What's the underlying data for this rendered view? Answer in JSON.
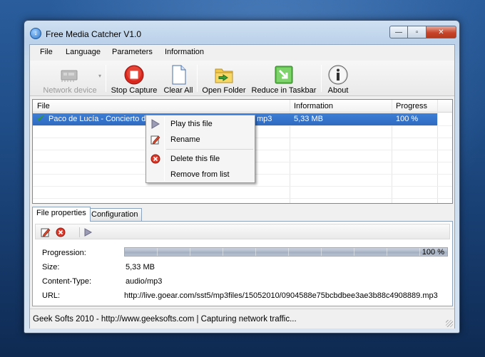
{
  "window": {
    "title": "Free Media Catcher V1.0",
    "controls": {
      "minimize": "—",
      "maximize": "▫",
      "close": "✕"
    }
  },
  "menu": [
    "File",
    "Language",
    "Parameters",
    "Information"
  ],
  "toolbar": {
    "network_device": "Network device",
    "stop_capture": "Stop Capture",
    "clear_all": "Clear All",
    "open_folder": "Open Folder",
    "reduce_taskbar": "Reduce in Taskbar",
    "about": "About"
  },
  "list": {
    "headers": {
      "file": "File",
      "information": "Information",
      "progress": "Progress"
    },
    "rows": [
      {
        "file": "Paco de Lucía - Concierto de Aranjuez.mp3",
        "file_tail": "mp3",
        "information": "5,33 MB",
        "progress": "100 %"
      }
    ]
  },
  "context_menu": {
    "play": "Play this file",
    "rename": "Rename",
    "delete": "Delete this file",
    "remove": "Remove from list"
  },
  "tabs": {
    "file_properties": "File properties",
    "configuration": "Configuration"
  },
  "properties": {
    "progression_label": "Progression:",
    "progression_value": "100 %",
    "progression_fraction": 1.0,
    "size_label": "Size:",
    "size_value": "5,33 MB",
    "content_type_label": "Content-Type:",
    "content_type_value": "audio/mp3",
    "url_label": "URL:",
    "url_value": "http://live.goear.com/sst5/mp3files/15052010/0904588e75bcbdbee3ae3b88c4908889.mp3"
  },
  "status": "Geek Softs 2010 - http://www.geeksofts.com  |  Capturing network traffic...",
  "colors": {
    "selection": "#3d7ed6",
    "stop_red": "#d8271d",
    "check_green": "#2f9a2f"
  }
}
